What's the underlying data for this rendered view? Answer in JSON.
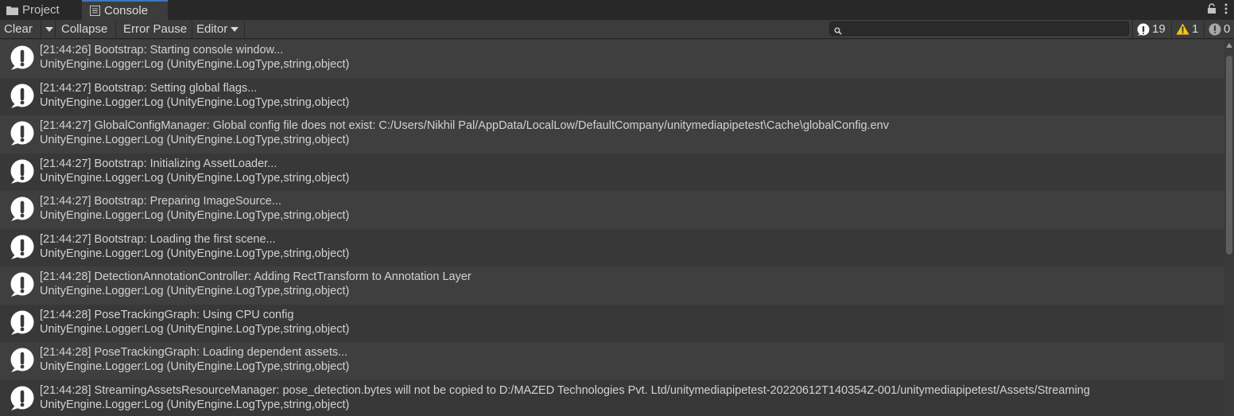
{
  "tabs": [
    {
      "label": "Project",
      "icon": "folder-icon"
    },
    {
      "label": "Console",
      "icon": "console-icon"
    }
  ],
  "toolbar": {
    "clear_label": "Clear",
    "collapse_label": "Collapse",
    "error_pause_label": "Error Pause",
    "editor_label": "Editor"
  },
  "search": {
    "value": "",
    "placeholder": ""
  },
  "counters": {
    "info": "19",
    "warning": "1",
    "error": "0"
  },
  "colors": {
    "info_icon": "#ffffff",
    "warning_icon": "#f5c518",
    "row_even": "#3f3f3f",
    "row_odd": "#383838"
  },
  "logs": [
    {
      "message": "[21:44:26] Bootstrap: Starting console window...",
      "stack": "UnityEngine.Logger:Log (UnityEngine.LogType,string,object)"
    },
    {
      "message": "[21:44:27] Bootstrap: Setting global flags...",
      "stack": "UnityEngine.Logger:Log (UnityEngine.LogType,string,object)"
    },
    {
      "message": "[21:44:27] GlobalConfigManager: Global config file does not exist: C:/Users/Nikhil Pal/AppData/LocalLow/DefaultCompany/unitymediapipetest\\Cache\\globalConfig.env",
      "stack": "UnityEngine.Logger:Log (UnityEngine.LogType,string,object)"
    },
    {
      "message": "[21:44:27] Bootstrap: Initializing AssetLoader...",
      "stack": "UnityEngine.Logger:Log (UnityEngine.LogType,string,object)"
    },
    {
      "message": "[21:44:27] Bootstrap: Preparing ImageSource...",
      "stack": "UnityEngine.Logger:Log (UnityEngine.LogType,string,object)"
    },
    {
      "message": "[21:44:27] Bootstrap: Loading the first scene...",
      "stack": "UnityEngine.Logger:Log (UnityEngine.LogType,string,object)"
    },
    {
      "message": "[21:44:28] DetectionAnnotationController: Adding RectTransform to Annotation Layer",
      "stack": "UnityEngine.Logger:Log (UnityEngine.LogType,string,object)"
    },
    {
      "message": "[21:44:28] PoseTrackingGraph: Using CPU config",
      "stack": "UnityEngine.Logger:Log (UnityEngine.LogType,string,object)"
    },
    {
      "message": "[21:44:28] PoseTrackingGraph: Loading dependent assets...",
      "stack": "UnityEngine.Logger:Log (UnityEngine.LogType,string,object)"
    },
    {
      "message": "[21:44:28] StreamingAssetsResourceManager: pose_detection.bytes will not be copied to D:/MAZED Technologies Pvt. Ltd/unitymediapipetest-20220612T140354Z-001/unitymediapipetest/Assets/Streaming",
      "stack": "UnityEngine.Logger:Log (UnityEngine.LogType,string,object)"
    }
  ]
}
